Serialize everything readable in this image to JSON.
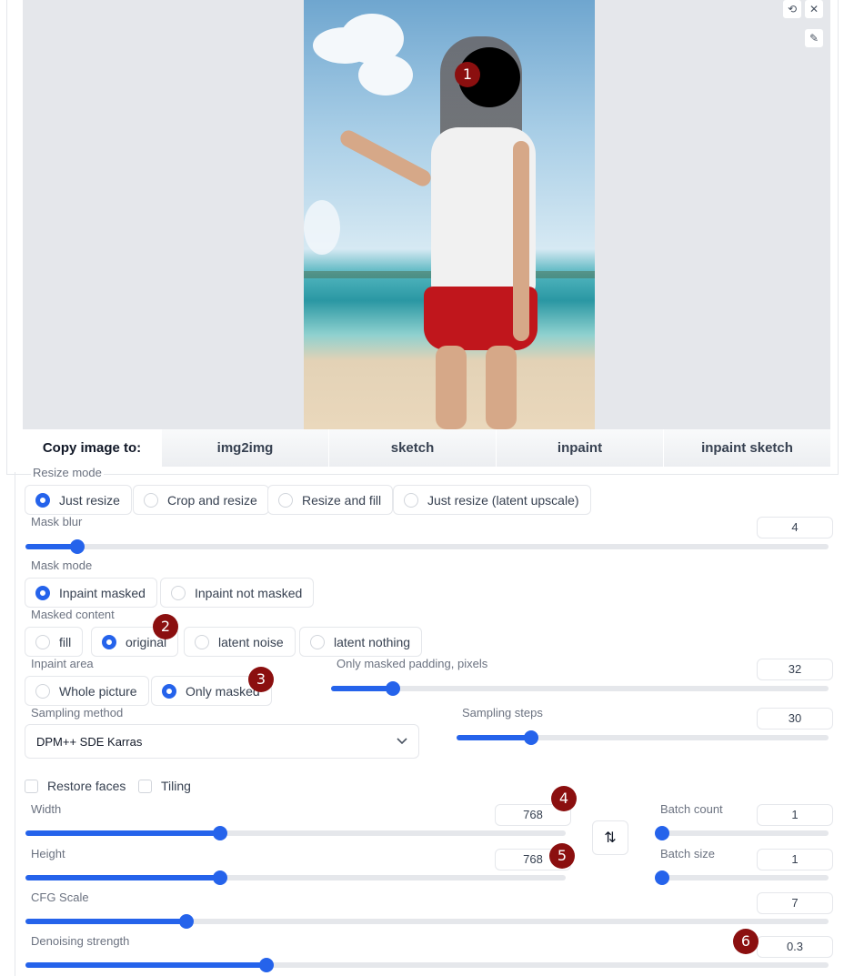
{
  "image_toolbar": {
    "undo_icon": "undo-icon",
    "close_icon": "close-icon",
    "brush_icon": "brush-icon"
  },
  "copy_bar": {
    "label": "Copy image to:",
    "buttons": [
      "img2img",
      "sketch",
      "inpaint",
      "inpaint sketch"
    ]
  },
  "resize_mode": {
    "label": "Resize mode",
    "options": [
      "Just resize",
      "Crop and resize",
      "Resize and fill",
      "Just resize (latent upscale)"
    ],
    "selected": "Just resize"
  },
  "mask_blur": {
    "label": "Mask blur",
    "value": "4",
    "fraction": 0.065
  },
  "mask_mode": {
    "label": "Mask mode",
    "options": [
      "Inpaint masked",
      "Inpaint not masked"
    ],
    "selected": "Inpaint masked"
  },
  "masked_content": {
    "label": "Masked content",
    "options": [
      "fill",
      "original",
      "latent noise",
      "latent nothing"
    ],
    "selected": "original"
  },
  "inpaint_area": {
    "label": "Inpaint area",
    "options": [
      "Whole picture",
      "Only masked"
    ],
    "selected": "Only masked"
  },
  "only_masked_padding": {
    "label": "Only masked padding, pixels",
    "value": "32",
    "fraction": 0.125
  },
  "sampling_method": {
    "label": "Sampling method",
    "value": "DPM++ SDE Karras",
    "chevron_icon": "chevron-down-icon"
  },
  "sampling_steps": {
    "label": "Sampling steps",
    "value": "30",
    "fraction": 0.2
  },
  "checkboxes": {
    "restore_faces": "Restore faces",
    "tiling": "Tiling"
  },
  "width": {
    "label": "Width",
    "value": "768",
    "fraction": 0.36
  },
  "height": {
    "label": "Height",
    "value": "768",
    "fraction": 0.36
  },
  "swap_icon": "swap-vertical-icon",
  "batch_count": {
    "label": "Batch count",
    "value": "1",
    "fraction": 0.0
  },
  "batch_size": {
    "label": "Batch size",
    "value": "1",
    "fraction": 0.0
  },
  "cfg_scale": {
    "label": "CFG Scale",
    "value": "7",
    "fraction": 0.2
  },
  "denoising_strength": {
    "label": "Denoising strength",
    "value": "0.3",
    "fraction": 0.3
  },
  "badges": [
    "1",
    "2",
    "3",
    "4",
    "5",
    "6"
  ],
  "accent_color": "#2563eb",
  "badge_color": "#8b0f0f"
}
